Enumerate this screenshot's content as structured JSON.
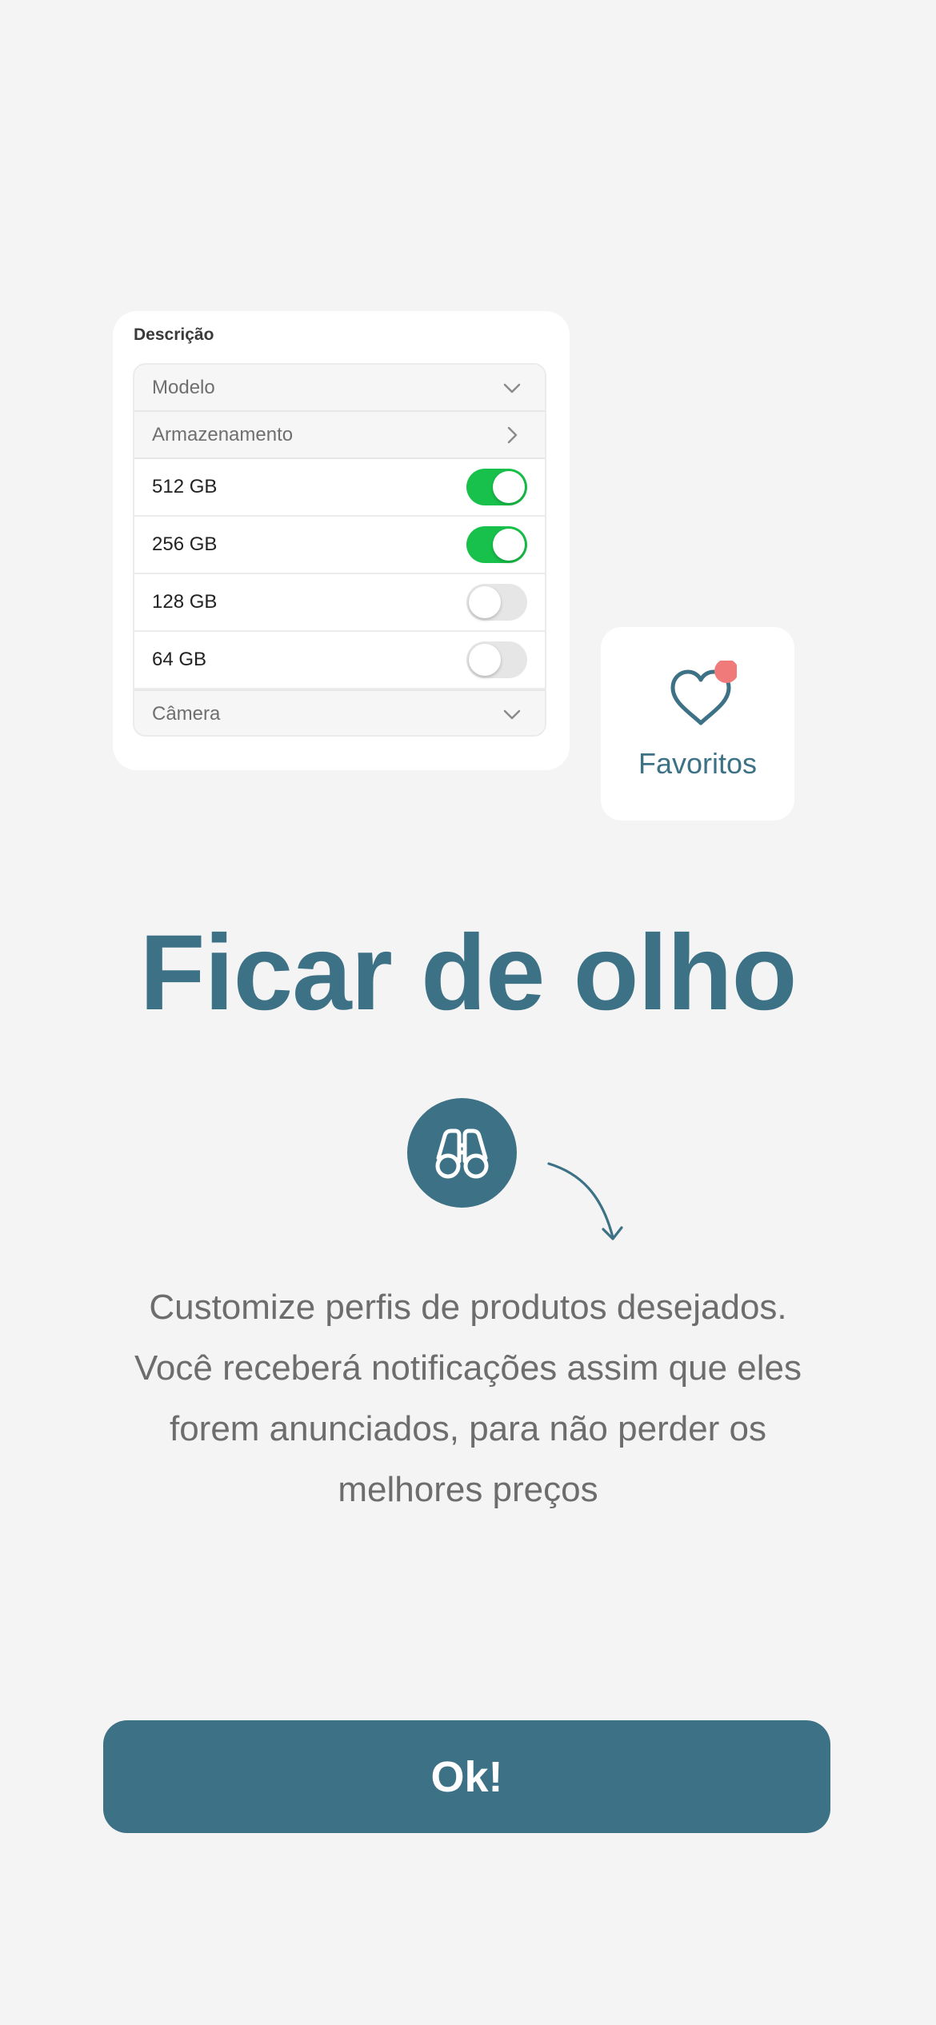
{
  "description_card": {
    "title": "Descrição",
    "sections": {
      "modelo": "Modelo",
      "armazenamento": "Armazenamento",
      "camera": "Câmera"
    },
    "storage_options": [
      {
        "label": "512 GB",
        "enabled": true
      },
      {
        "label": "256 GB",
        "enabled": true
      },
      {
        "label": "128 GB",
        "enabled": false
      },
      {
        "label": "64 GB",
        "enabled": false
      }
    ]
  },
  "favorites_card": {
    "label": "Favoritos",
    "icon": "heart-icon",
    "badge": "notification-dot"
  },
  "onboarding": {
    "title": "Ficar de olho",
    "icon": "binoculars-icon",
    "body": "Customize perfis de produtos desejados. Você receberá notificações assim que eles forem anunciados, para não perder os melhores preços",
    "button_label": "Ok!"
  },
  "colors": {
    "background": "#f4f4f4",
    "primary": "#3d7186",
    "toggle_on": "#18c14b",
    "toggle_off": "#e6e6e6",
    "badge": "#f07a7a",
    "body_text": "#6d6d6d"
  }
}
